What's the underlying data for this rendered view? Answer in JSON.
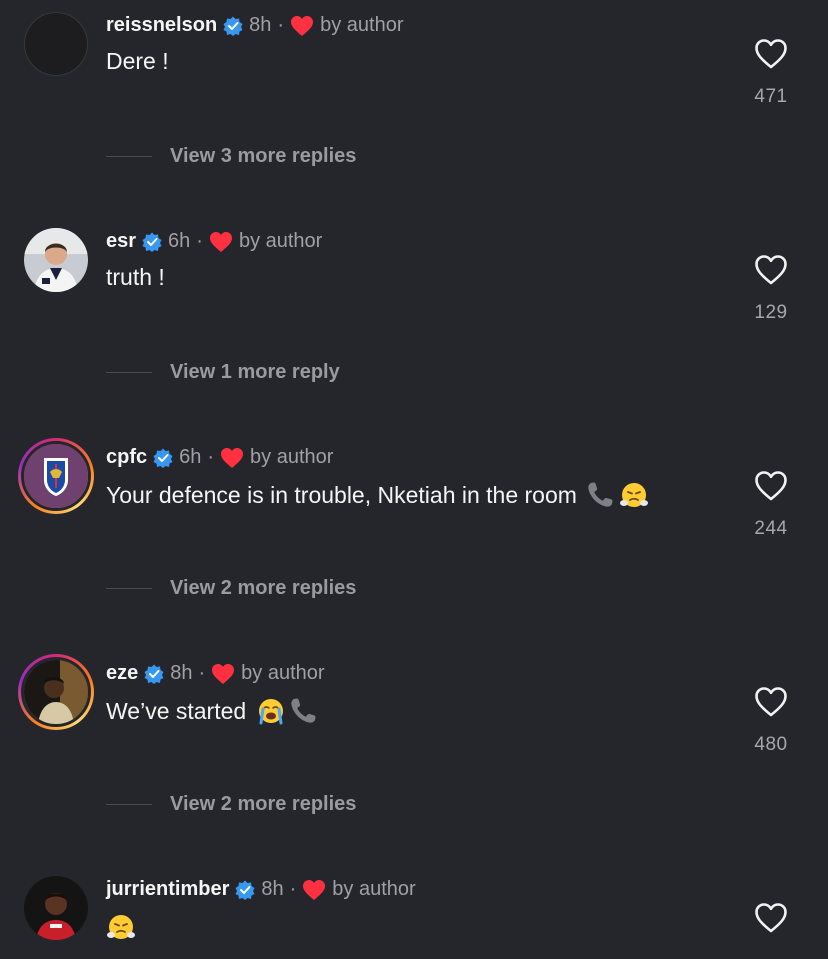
{
  "comments": [
    {
      "username": "reissnelson",
      "time": "8h",
      "dot": "·",
      "by_author": "by author",
      "text": "Dere !",
      "likes": "471",
      "emojis": []
    },
    {
      "username": "esr",
      "time": "6h",
      "dot": "·",
      "by_author": "by author",
      "text": "truth !",
      "likes": "129",
      "emojis": []
    },
    {
      "username": "cpfc",
      "time": "6h",
      "dot": "·",
      "by_author": "by author",
      "text": "Your defence is in trouble, Nketiah in the room",
      "likes": "244",
      "emojis": [
        "telephone-receiver",
        "face-with-steam-from-nose"
      ]
    },
    {
      "username": "eze",
      "time": "8h",
      "dot": "·",
      "by_author": "by author",
      "text": "We’ve started",
      "likes": "480",
      "emojis": [
        "loudly-crying-face",
        "telephone-receiver"
      ]
    },
    {
      "username": "jurrientimber",
      "time": "8h",
      "dot": "·",
      "by_author": "by author",
      "text": "",
      "likes": "",
      "emojis": [
        "face-with-steam-from-nose"
      ]
    }
  ],
  "replies": [
    {
      "label": "View 3 more replies"
    },
    {
      "label": "View 1 more reply"
    },
    {
      "label": "View 2 more replies"
    },
    {
      "label": "View 2 more replies"
    }
  ],
  "colors": {
    "background": "#25262b",
    "verified": "#3897f0",
    "heart_red": "#ff3040",
    "muted_text": "#a0a0a5"
  }
}
